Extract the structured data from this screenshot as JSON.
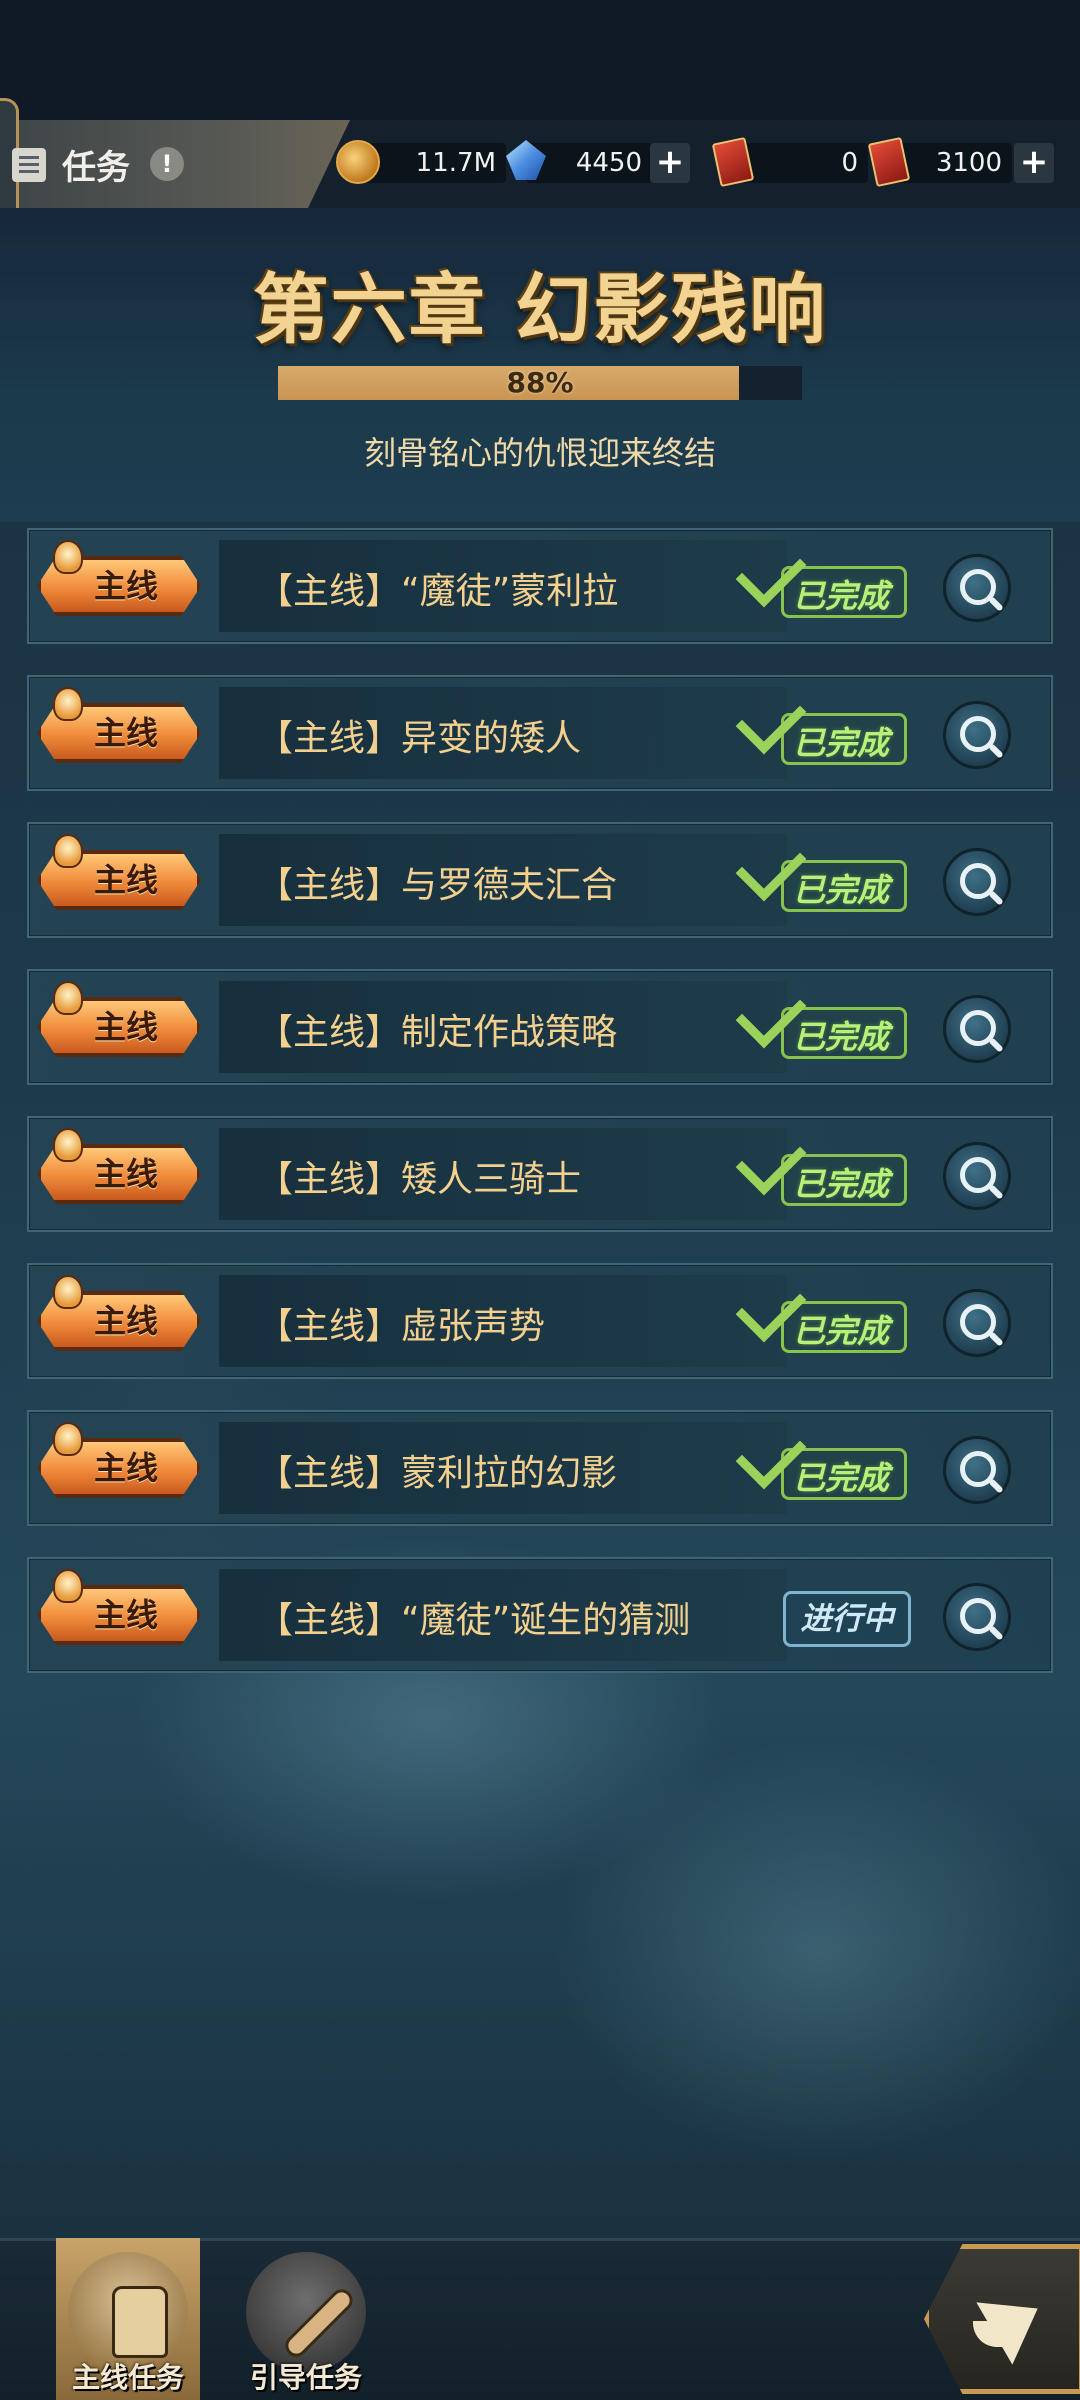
{
  "header": {
    "title": "任务",
    "info_glyph": "!"
  },
  "resources": [
    {
      "icon": "coin-icon",
      "value": "11.7M",
      "has_plus": false
    },
    {
      "icon": "crystal-icon",
      "value": "4450",
      "has_plus": true
    },
    {
      "icon": "card-icon",
      "value": "0",
      "has_plus": false
    },
    {
      "icon": "card-icon",
      "value": "3100",
      "has_plus": true
    }
  ],
  "chapter": {
    "title": "第六章 幻影残响",
    "progress_percent": 88,
    "progress_label": "88%",
    "subtitle": "刻骨铭心的仇恨迎来终结"
  },
  "quest_tag_label": "主线",
  "quests": [
    {
      "name": "【主线】“魔徒”蒙利拉",
      "status": "done",
      "status_label": "已完成"
    },
    {
      "name": "【主线】异变的矮人",
      "status": "done",
      "status_label": "已完成"
    },
    {
      "name": "【主线】与罗德夫汇合",
      "status": "done",
      "status_label": "已完成"
    },
    {
      "name": "【主线】制定作战策略",
      "status": "done",
      "status_label": "已完成"
    },
    {
      "name": "【主线】矮人三骑士",
      "status": "done",
      "status_label": "已完成"
    },
    {
      "name": "【主线】虚张声势",
      "status": "done",
      "status_label": "已完成"
    },
    {
      "name": "【主线】蒙利拉的幻影",
      "status": "done",
      "status_label": "已完成"
    },
    {
      "name": "【主线】“魔徒”诞生的猜测",
      "status": "in_progress",
      "status_label": "进行中"
    }
  ],
  "bottom_tabs": [
    {
      "label": "主线任务",
      "icon": "scroll-icon",
      "active": true
    },
    {
      "label": "引导任务",
      "icon": "bone-icon",
      "active": false
    }
  ],
  "colors": {
    "accent_gold": "#f3d391",
    "done_green": "#9ad25a",
    "in_progress_blue": "#7fb6cf",
    "progress_fill": "#d7aa6b"
  }
}
